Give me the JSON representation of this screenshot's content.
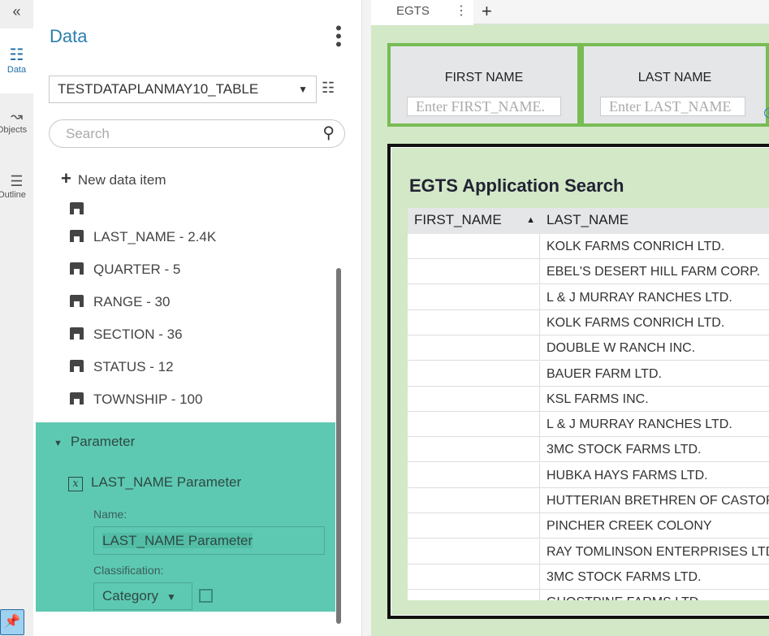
{
  "rail": {
    "collapse": "«",
    "items": [
      {
        "label": "Data"
      },
      {
        "label": "Objects"
      },
      {
        "label": "Outline"
      }
    ]
  },
  "panel": {
    "title": "Data",
    "table_select": "TESTDATAPLANMAY10_TABLE",
    "search_placeholder": "Search",
    "new_item": "New data item",
    "items": [
      {
        "label": "LAST_NAME - 2.4K"
      },
      {
        "label": "QUARTER - 5"
      },
      {
        "label": "RANGE - 30"
      },
      {
        "label": "SECTION - 36"
      },
      {
        "label": "STATUS - 12"
      },
      {
        "label": "TOWNSHIP - 100"
      }
    ],
    "parameter": {
      "header": "Parameter",
      "name": "LAST_NAME Parameter",
      "name_label": "Name:",
      "name_value": "LAST_NAME Parameter",
      "class_label": "Classification:",
      "class_value": "Category"
    }
  },
  "main": {
    "tab": "EGTS",
    "first_name": {
      "title": "FIRST NAME",
      "placeholder": "Enter FIRST_NAME."
    },
    "last_name": {
      "title": "LAST NAME",
      "placeholder": "Enter LAST_NAME"
    },
    "table": {
      "title": "EGTS Application Search",
      "columns": [
        "FIRST_NAME",
        "LAST_NAME"
      ],
      "sort": "▲",
      "rows": [
        "KOLK FARMS CONRICH LTD.",
        "EBEL'S DESERT HILL FARM CORP.",
        "L & J MURRAY RANCHES LTD.",
        "KOLK FARMS CONRICH LTD.",
        "DOUBLE W RANCH INC.",
        "BAUER FARM LTD.",
        "KSL FARMS INC.",
        "L & J MURRAY RANCHES LTD.",
        "3MC STOCK FARMS LTD.",
        "HUBKA HAYS FARMS LTD.",
        "HUTTERIAN BRETHREN OF CASTOR",
        "PINCHER CREEK COLONY",
        "RAY TOMLINSON ENTERPRISES LTD.",
        "3MC STOCK FARMS LTD.",
        "GHOSTPINE FARMS LTD."
      ]
    }
  }
}
